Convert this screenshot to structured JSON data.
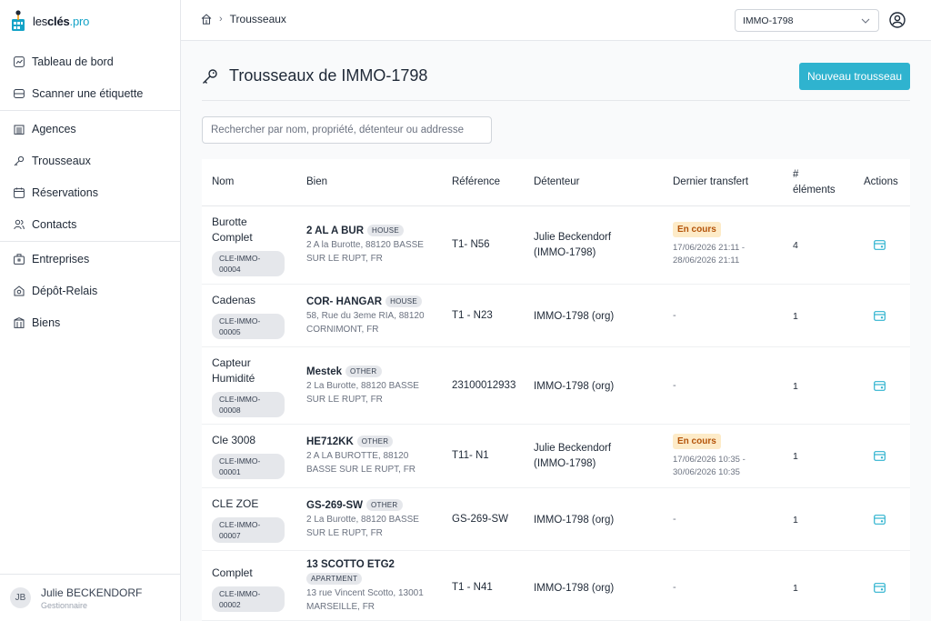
{
  "brand": {
    "pre": "les",
    "bold": "clés",
    "suffix": ".pro"
  },
  "colors": {
    "accent": "#2fb3cf",
    "status_bg": "#fdebc8",
    "status_text": "#b45309"
  },
  "sidebar": {
    "items": [
      {
        "label": "Tableau de bord",
        "icon": "chart-icon"
      },
      {
        "label": "Scanner une étiquette",
        "icon": "scan-icon"
      },
      {
        "label": "Agences",
        "icon": "building-icon"
      },
      {
        "label": "Trousseaux",
        "icon": "key-icon"
      },
      {
        "label": "Réservations",
        "icon": "calendar-icon"
      },
      {
        "label": "Contacts",
        "icon": "users-icon"
      },
      {
        "label": "Entreprises",
        "icon": "briefcase-icon"
      },
      {
        "label": "Dépôt-Relais",
        "icon": "relay-icon"
      },
      {
        "label": "Biens",
        "icon": "house-icon"
      }
    ],
    "user": {
      "initials": "JB",
      "name": "Julie BECKENDORF",
      "role": "Gestionnaire"
    }
  },
  "header": {
    "breadcrumb": "Trousseaux",
    "org_selected": "IMMO-1798"
  },
  "page": {
    "title": "Trousseaux de IMMO-1798",
    "new_button": "Nouveau trousseau",
    "search_placeholder": "Rechercher par nom, propriété, détenteur ou addresse"
  },
  "table": {
    "headers": {
      "nom": "Nom",
      "bien": "Bien",
      "reference": "Référence",
      "detenteur": "Détenteur",
      "transfert": "Dernier transfert",
      "elements_1": "#",
      "elements_2": "éléments",
      "actions": "Actions"
    },
    "rows": [
      {
        "name": "Burotte Complet",
        "code": "CLE-IMMO-00004",
        "bien": "2 AL A BUR",
        "type": "HOUSE",
        "address": "2 A la Burotte, 88120 BASSE SUR LE RUPT, FR",
        "reference": "T1- N56",
        "holder": "Julie Beckendorf (IMMO-1798)",
        "status": "En cours",
        "dates": "17/06/2026 21:11 - 28/06/2026 21:11",
        "count": "4"
      },
      {
        "name": "Cadenas",
        "code": "CLE-IMMO-00005",
        "bien": "COR- HANGAR",
        "type": "HOUSE",
        "address": "58, Rue du 3eme RIA, 88120 CORNIMONT, FR",
        "reference": "T1 - N23",
        "holder": "IMMO-1798 (org)",
        "status": "",
        "dates": "-",
        "count": "1"
      },
      {
        "name": "Capteur Humidité",
        "code": "CLE-IMMO-00008",
        "bien": "Mestek",
        "type": "OTHER",
        "address": "2 La Burotte, 88120 BASSE SUR LE RUPT, FR",
        "reference": "23100012933",
        "holder": "IMMO-1798 (org)",
        "status": "",
        "dates": "-",
        "count": "1"
      },
      {
        "name": "Cle 3008",
        "code": "CLE-IMMO-00001",
        "bien": "HE712KK",
        "type": "OTHER",
        "address": "2 A LA BUROTTE, 88120 BASSE SUR LE RUPT, FR",
        "reference": "T11- N1",
        "holder": "Julie Beckendorf (IMMO-1798)",
        "status": "En cours",
        "dates": "17/06/2026 10:35 - 30/06/2026 10:35",
        "count": "1"
      },
      {
        "name": "CLE ZOE",
        "code": "CLE-IMMO-00007",
        "bien": "GS-269-SW",
        "type": "OTHER",
        "address": "2 La Burotte, 88120 BASSE SUR LE RUPT, FR",
        "reference": "GS-269-SW",
        "holder": "IMMO-1798 (org)",
        "status": "",
        "dates": "-",
        "count": "1"
      },
      {
        "name": "Complet",
        "code": "CLE-IMMO-00002",
        "bien": "13 SCOTTO ETG2",
        "type": "APARTMENT",
        "address": "13 rue Vincent Scotto, 13001 MARSEILLE, FR",
        "reference": "T1 - N41",
        "holder": "IMMO-1798 (org)",
        "status": "",
        "dates": "-",
        "count": "1"
      }
    ]
  }
}
